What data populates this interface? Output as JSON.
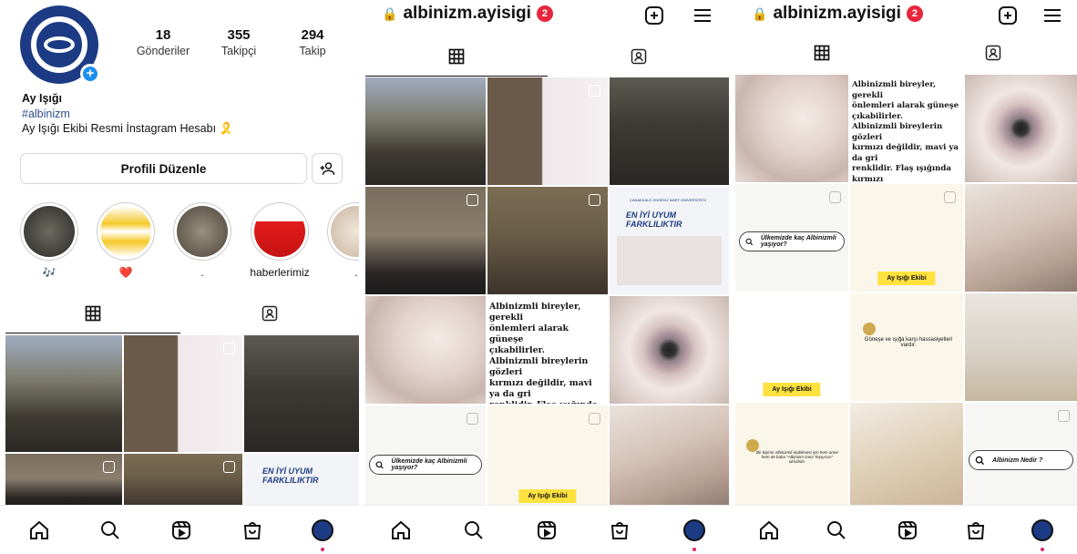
{
  "profile": {
    "stats": [
      {
        "num": "18",
        "label": "Gönderiler"
      },
      {
        "num": "355",
        "label": "Takipçi"
      },
      {
        "num": "294",
        "label": "Takip"
      }
    ],
    "name": "Ay Işığı",
    "hashtag": "#albinizm",
    "bio": "Ay Işığı Ekibi Resmi İnstagram Hesabı 🎗️",
    "edit_button": "Profili Düzenle",
    "highlights": [
      {
        "caption": "🎶"
      },
      {
        "caption": "❤️"
      },
      {
        "caption": "."
      },
      {
        "caption": "haberlerimiz"
      },
      {
        "caption": "."
      }
    ]
  },
  "username": "albinizm.ayisigi",
  "notification_count": "2",
  "lock_glyph": "🔒",
  "posts": {
    "albino_facts_text": "Albinizmli bireyler, gerekli\nönlemleri alarak güneşe\nçıkabilirler.\nAlbinizmli bireylerin gözleri\nkırmızı değildir, mavi ya da gri\nrenklidir. Flaş ışığında kırmızı\ngibi görünür.\nAlbinizm bir hastalık değil,\ngenetik bir durumdur.",
    "question_country": "Ülkemizde kaç Albinizmli yaşıyor?",
    "team_tag": "Ay Işığı Ekibi",
    "sun_question": "Güneşe ve ışığa karşı hassasiyetleri vardır.",
    "what_is": "Albinizm Nedir ?",
    "quote": "Bir kişinin Albinizmli olabilmesi için hem anne hem de baba \"Albinizm Geni Taşıyıcısı\" olmalıdır.",
    "poster_title": "EN İYİ UYUM FARKLILIKTIR",
    "uni_name": "ÇANAKKALE ONSEKİZ MART ÜNİVERSİTESİ"
  },
  "colors": {
    "brand": "#1d3b84",
    "notif": "#e8263c",
    "plus": "#1d8ff0",
    "tag": "#ffe23f"
  },
  "icons": [
    "plus-square-icon",
    "menu-icon",
    "grid-icon",
    "tagged-icon",
    "home-icon",
    "search-icon",
    "reels-icon",
    "shop-icon",
    "profile-avatar-icon",
    "add-person-icon",
    "lock-icon"
  ]
}
